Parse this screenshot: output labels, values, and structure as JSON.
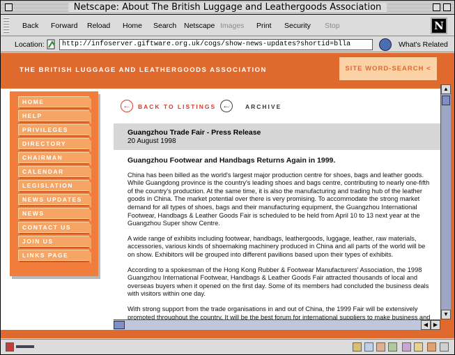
{
  "window": {
    "title": "Netscape: About The British Luggage and Leathergoods Association"
  },
  "toolbar": {
    "buttons": [
      {
        "label": "Back",
        "enabled": true
      },
      {
        "label": "Forward",
        "enabled": true
      },
      {
        "label": "Reload",
        "enabled": true
      },
      {
        "label": "Home",
        "enabled": true
      },
      {
        "label": "Search",
        "enabled": true
      },
      {
        "label": "Netscape",
        "enabled": true
      },
      {
        "label": "Images",
        "enabled": false
      },
      {
        "label": "Print",
        "enabled": true
      },
      {
        "label": "Security",
        "enabled": true
      },
      {
        "label": "Stop",
        "enabled": false
      }
    ],
    "logo": "N"
  },
  "location": {
    "label": "Location:",
    "url": "http://infoserver.giftware.org.uk/cogs/show-news-updates?shortid=blla",
    "related_label": "What's Related"
  },
  "site": {
    "title": "THE BRITISH LUGGAGE AND LEATHERGOODS ASSOCIATION",
    "word_search": "SITE WORD-SEARCH <",
    "accent": "#e06a2e"
  },
  "nav": {
    "items": [
      {
        "label": "HOME"
      },
      {
        "label": "HELP"
      },
      {
        "label": "PRIVILEGES"
      },
      {
        "label": "DIRECTORY"
      },
      {
        "label": "CHAIRMAN"
      },
      {
        "label": "CALENDAR"
      },
      {
        "label": "LEGISLATION"
      },
      {
        "label": "NEWS UPDATES"
      },
      {
        "label": "NEWS"
      },
      {
        "label": "CONTACT US"
      },
      {
        "label": "JOIN US"
      },
      {
        "label": "LINKS PAGE"
      }
    ]
  },
  "main": {
    "back_label": "BACK TO LISTINGS",
    "archive_label": "ARCHIVE",
    "release_title": "Guangzhou Trade Fair - Press Release",
    "release_date": "20 August 1998",
    "headline": "Guangzhou Footwear and Handbags Returns Again in 1999.",
    "paragraphs": [
      "China has been billed as the world's largest major production centre for shoes, bags and leather goods. While Guangdong province is the country's leading shoes and bags centre, contributing to nearly one-fifth of the country's production. At the same time, it is also the manufacturing and trading hub of the leather goods in China. The market potential over there is very promising. To accommodate the strong market demand for all types of shoes, bags and their manufacturing equipment, the Guangzhou International Footwear, Handbags & Leather Goods Fair is scheduled to be held from April 10 to 13 next year at the Guangzhou Super show Centre.",
      "A wide range of exhibits including footwear, handbags, leathergoods, luggage, leather, raw materials, accessories, various kinds of shoemaking machinery produced in China and all parts of the world will be on show. Exhibitors will be grouped into different pavilions based upon their types of exhibits.",
      "According to a spokesman of the Hong Kong Rubber & Footwear Manufacturers' Association, the 1998 Guangzhou International Footwear, Handbags & Leather Goods Fair attracted thousands of local and overseas buyers when it opened on the first day. Some of its members had concluded the business deals with visitors within one day.",
      "With strong support from the trade organisations in and out of China, the 1999 Fair will be extensively promoted throughout the country. It will be the best forum for international suppliers to make business and establish contacts with important buyers coming from all parts of the country. The expected number of exhibitors will be 300 coming from 12 countries including China, Hong Kong, Taiwan, Japan, Singapore,"
    ]
  },
  "status": {
    "text": ""
  }
}
